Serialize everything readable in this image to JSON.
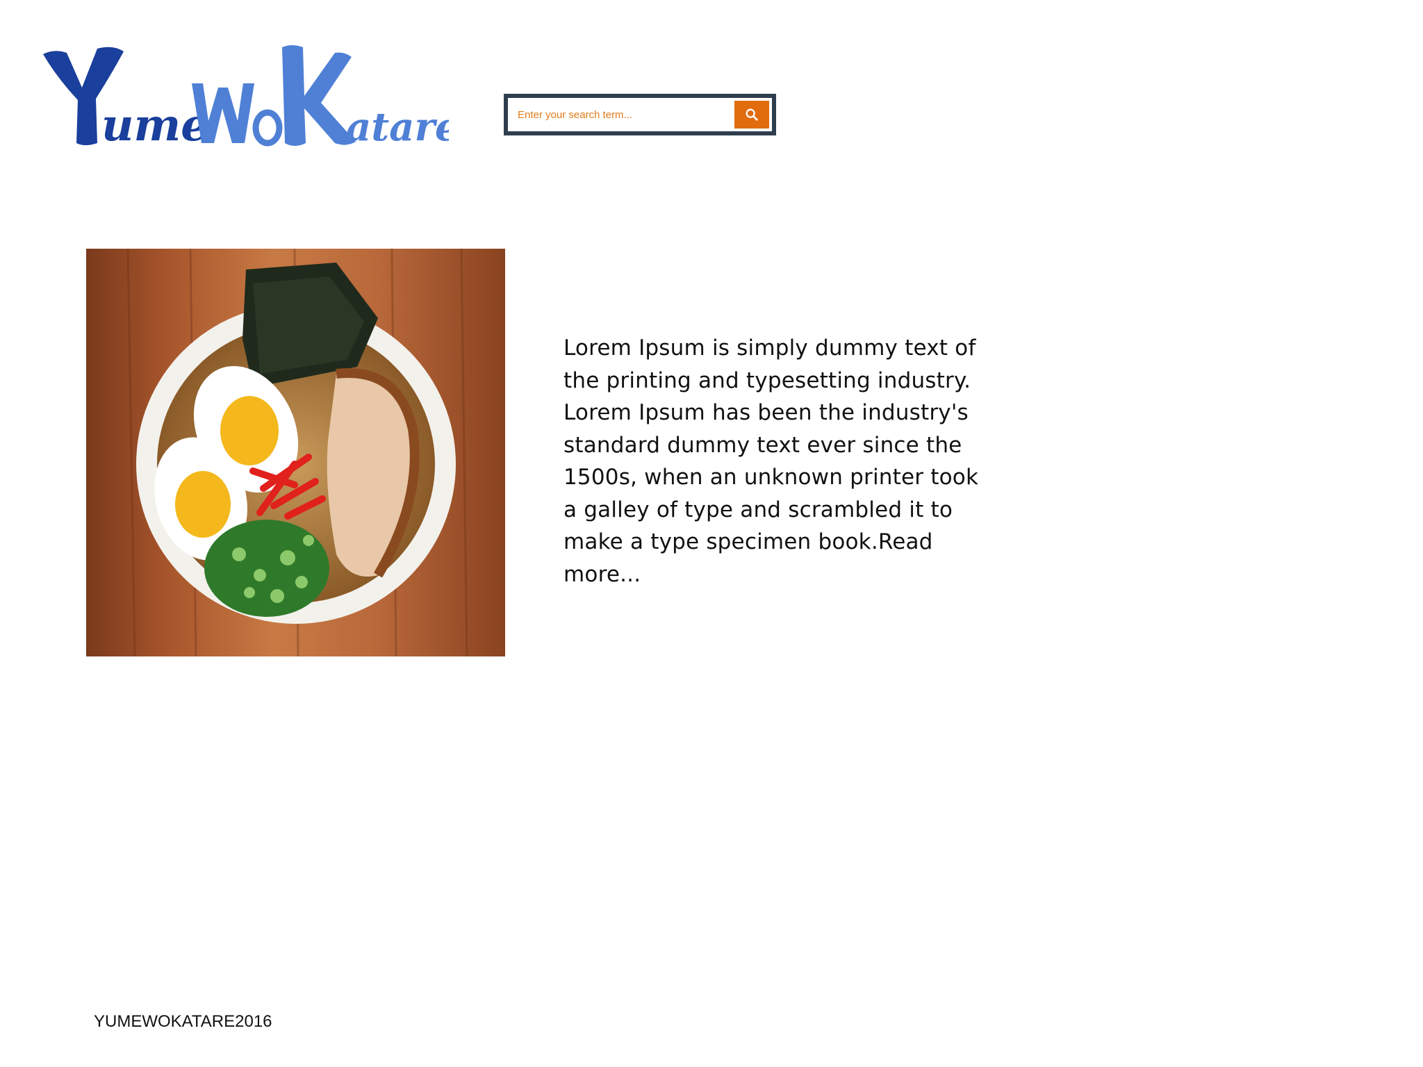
{
  "header": {
    "logo_text": "YumeWoKatare",
    "search": {
      "placeholder": "Enter your search term...",
      "button_icon": "search-icon"
    }
  },
  "main": {
    "image_alt": "Bowl of ramen with eggs, pork, nori and scallions",
    "intro_text": "Lorem Ipsum is simply dummy text of the printing and typesetting industry. Lorem Ipsum has been the industry's standard dummy text ever since the 1500s, when an unknown printer took a galley of type and scrambled it to make a type specimen book.Read more..."
  },
  "footer": {
    "copyright": "YUMEWOKATARE2016"
  },
  "colors": {
    "logo_dark_blue": "#1a3f9c",
    "logo_light_blue": "#4f80d6",
    "search_border": "#2f3e4f",
    "search_button": "#e06c0e",
    "placeholder_text": "#e07b1a"
  }
}
